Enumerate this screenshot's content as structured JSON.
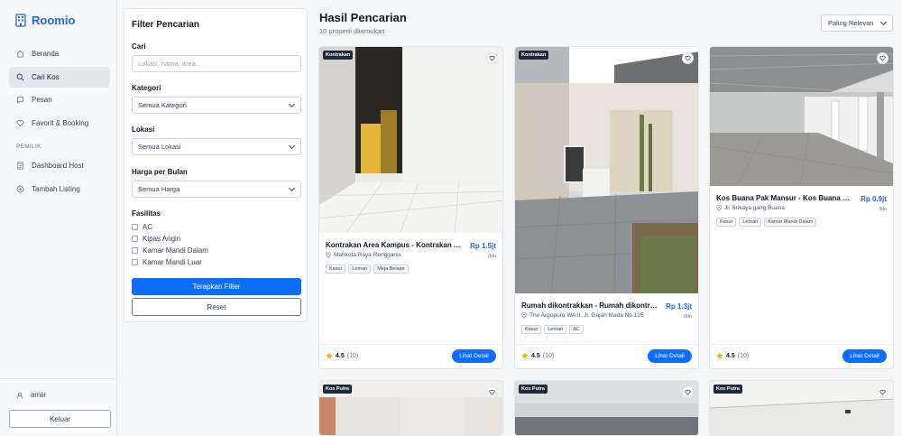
{
  "app": {
    "brand": "Roomio"
  },
  "sidebar": {
    "items": [
      {
        "label": "Beranda",
        "icon": "home-icon"
      },
      {
        "label": "Cari Kos",
        "icon": "search-icon",
        "active": true
      },
      {
        "label": "Pesan",
        "icon": "chat-icon"
      },
      {
        "label": "Favorit & Booking",
        "icon": "heart-icon"
      }
    ],
    "section_owner": "PEMILIK",
    "owner_items": [
      {
        "label": "Dashboard Host",
        "icon": "building-icon"
      },
      {
        "label": "Tambah Listing",
        "icon": "plus-circle-icon"
      }
    ],
    "user": "amiir",
    "logout_label": "Keluar"
  },
  "filter": {
    "title": "Filter Pencarian",
    "search_label": "Cari",
    "search_placeholder": "Lokasi, nama, area...",
    "category_label": "Kategori",
    "category_value": "Semua Kategori",
    "location_label": "Lokasi",
    "location_value": "Semua Lokasi",
    "price_label": "Harga per Bulan",
    "price_value": "Semua Harga",
    "facilities_label": "Fasilitas",
    "facilities": [
      "AC",
      "Kipas Angin",
      "Kamar Mandi Dalam",
      "Kamar Mandi Luar"
    ],
    "apply_label": "Terapkan Filter",
    "reset_label": "Reset"
  },
  "results": {
    "title": "Hasil Pencarian",
    "count": "10 properti ditemukan",
    "sort_value": "Paling Relevan",
    "cards": [
      {
        "badge": "Kontrakan",
        "name": "Kontrakan Area Kampus - Kontrakan Area Kampus",
        "price": "Rp 1.5jt",
        "per": "/bln",
        "address": "Mahkota Raya Rengganis",
        "tags": [
          "Kasur",
          "Lemari",
          "Meja Belajar"
        ],
        "rating": "4.5",
        "reviews": "(10)",
        "button": "Lihat Detail"
      },
      {
        "badge": "Kontrakan",
        "name": "Rumah dikontrakkan - Rumah dikontrakkan",
        "price": "Rp 1.3jt",
        "per": "/bln",
        "address": "The Argopuro WA II, Jl. Gajah Mada No.125",
        "tags": [
          "Kasur",
          "Lemari",
          "AC"
        ],
        "rating": "4.5",
        "reviews": "(10)",
        "button": "Lihat Detail"
      },
      {
        "badge": "",
        "name": "Kos Buana Pak Mansur - Kos Buana Pak Mansur",
        "price": "Rp 0.9jt",
        "per": "/bln",
        "address": "Jl. Srikaya gang Buana",
        "tags": [
          "Kasur",
          "Lemari",
          "Kamar Mandi Dalam"
        ],
        "rating": "4.5",
        "reviews": "(10)",
        "button": "Lihat Detail"
      },
      {
        "badge": "Kos Putra"
      },
      {
        "badge": "Kos Putra"
      },
      {
        "badge": "Kos Putra"
      }
    ]
  },
  "colors": {
    "accent": "#0d6efd",
    "brand": "#2563eb",
    "star": "#f5b301"
  }
}
